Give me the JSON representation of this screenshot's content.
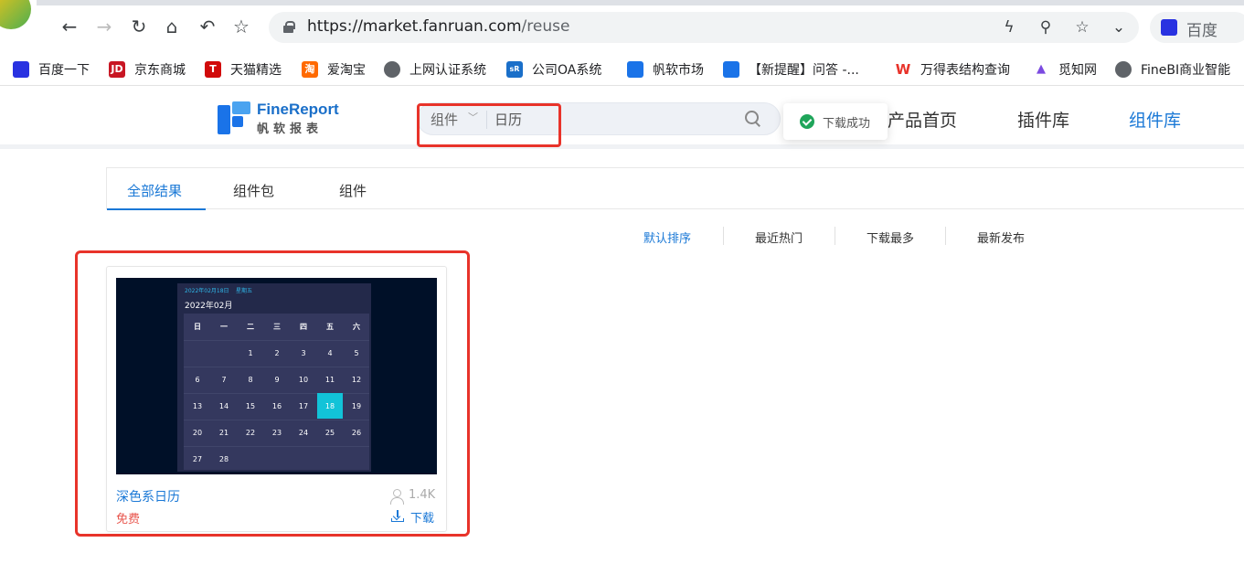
{
  "browser": {
    "url_host": "https://market.fanruan.com",
    "url_path": "/reuse",
    "search_engine": "百度",
    "icons": [
      "back-icon",
      "forward-icon",
      "reload-icon",
      "home-icon",
      "undo-icon",
      "star-icon"
    ]
  },
  "bookmarks": [
    {
      "label": "百度一下",
      "icon": "baidu-paw-icon",
      "color": "#2932e1"
    },
    {
      "label": "京东商城",
      "icon": "jd-icon",
      "color": "#c81623"
    },
    {
      "label": "天猫精选",
      "icon": "tmall-icon",
      "color": "#d10a0a"
    },
    {
      "label": "爱淘宝",
      "icon": "taobao-icon",
      "color": "#ff6a00"
    },
    {
      "label": "上网认证系统",
      "icon": "globe-icon",
      "color": "#5f6368"
    },
    {
      "label": "公司OA系统",
      "icon": "oa-icon",
      "color": "#1a6fc9"
    },
    {
      "label": "帆软市场",
      "icon": "fanruan-icon",
      "color": "#1a73e8"
    },
    {
      "label": "【新提醒】问答 -...",
      "icon": "fanruan-icon",
      "color": "#1a73e8"
    },
    {
      "label": "万得表结构查询",
      "icon": "wind-icon",
      "color": "#e8332a"
    },
    {
      "label": "觅知网",
      "icon": "mizhi-icon",
      "color": "#7b4ae0"
    },
    {
      "label": "FineBI商业智能",
      "icon": "globe-icon",
      "color": "#5f6368"
    }
  ],
  "header": {
    "logo_en": "FineReport",
    "logo_cn": "帆软报表",
    "search_category": "组件",
    "search_value": "日历",
    "nav": [
      "产品首页",
      "插件库",
      "组件库"
    ],
    "nav_active": "组件库",
    "toast": "下载成功"
  },
  "results": {
    "tabs": [
      "全部结果",
      "组件包",
      "组件"
    ],
    "sort_options": [
      "默认排序",
      "最近热门",
      "下载最多",
      "最新发布"
    ],
    "card": {
      "title": "深色系日历",
      "price": "免费",
      "downloads": "1.4K",
      "download_label": "下载",
      "preview": {
        "header_date": "2022年02月18日",
        "header_weekday": "星期五",
        "month": "2022年02月",
        "weekdays": [
          "日",
          "一",
          "二",
          "三",
          "四",
          "五",
          "六"
        ],
        "selected_day": "18",
        "weeks": [
          [
            "",
            "",
            "1",
            "2",
            "3",
            "4",
            "5"
          ],
          [
            "6",
            "7",
            "8",
            "9",
            "10",
            "11",
            "12"
          ],
          [
            "13",
            "14",
            "15",
            "16",
            "17",
            "18",
            "19"
          ],
          [
            "20",
            "21",
            "22",
            "23",
            "24",
            "25",
            "26"
          ],
          [
            "27",
            "28",
            "",
            "",
            "",
            "",
            ""
          ]
        ]
      }
    }
  },
  "colors": {
    "accent": "#1a78d6",
    "price": "#e8554d",
    "highlight_box": "#e8332a",
    "calendar_bg": "#001028",
    "calendar_selected": "#12c3d8"
  }
}
